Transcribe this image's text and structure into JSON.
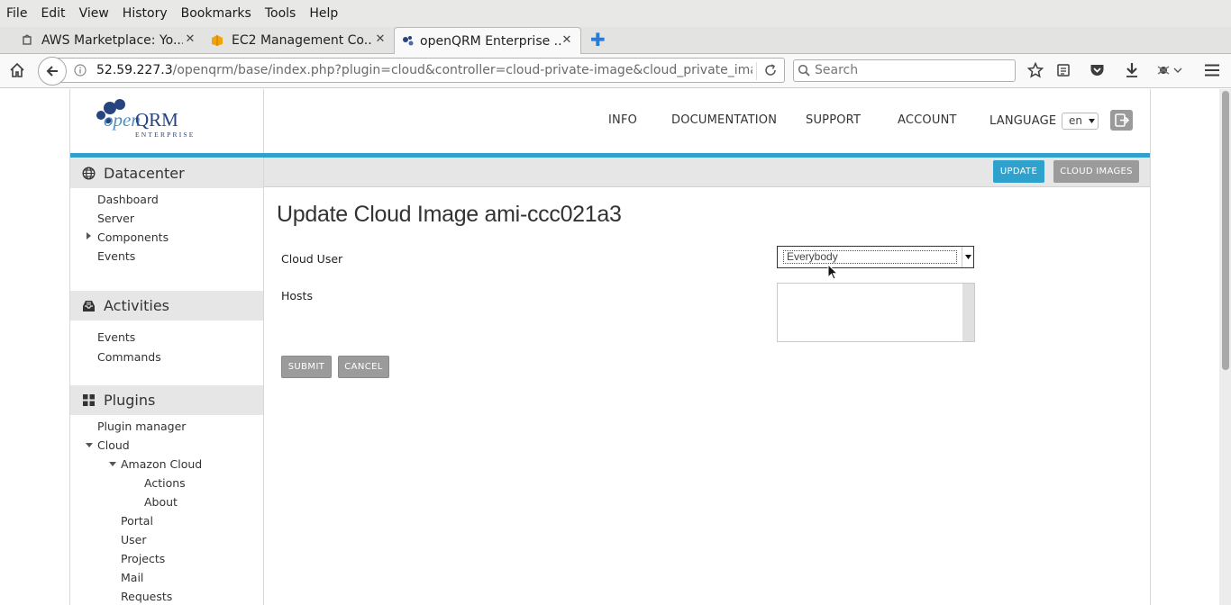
{
  "browser": {
    "menu": [
      "File",
      "Edit",
      "View",
      "History",
      "Bookmarks",
      "Tools",
      "Help"
    ],
    "menu_mnemonics": [
      "F",
      "E",
      "V",
      "s",
      "B",
      "T",
      "H"
    ],
    "tabs": [
      {
        "label": "AWS Marketplace: Yo...",
        "icon": "aws-icon"
      },
      {
        "label": "EC2 Management Co...",
        "icon": "cube-icon"
      },
      {
        "label": "openQRM Enterprise ...",
        "icon": "openqrm-icon",
        "active": true
      }
    ],
    "url_host": "52.59.227.3",
    "url_path": "/openqrm/base/index.php?plugin=cloud&controller=cloud-private-image&cloud_private_image=",
    "search_placeholder": "Search"
  },
  "header": {
    "logo_text_open": "open",
    "logo_text_qrm": "QRM",
    "logo_sub": "ENTERPRISE",
    "nav": [
      "INFO",
      "DOCUMENTATION",
      "SUPPORT",
      "ACCOUNT"
    ],
    "language_label": "LANGUAGE",
    "language_value": "en"
  },
  "toolbar": {
    "update_label": "UPDATE",
    "cloud_images_label": "CLOUD IMAGES"
  },
  "sidebar": {
    "datacenter": {
      "title": "Datacenter",
      "items": [
        "Dashboard",
        "Server",
        "Components",
        "Events"
      ]
    },
    "activities": {
      "title": "Activities",
      "items": [
        "Events",
        "Commands"
      ]
    },
    "plugins": {
      "title": "Plugins",
      "items": {
        "plugin_manager": "Plugin manager",
        "cloud": "Cloud",
        "amazon_cloud": "Amazon Cloud",
        "actions": "Actions",
        "about": "About",
        "portal": "Portal",
        "user": "User",
        "projects": "Projects",
        "mail": "Mail",
        "requests": "Requests"
      }
    }
  },
  "main": {
    "title": "Update Cloud Image ami-ccc021a3",
    "cloud_user_label": "Cloud User",
    "cloud_user_value": "Everybody",
    "hosts_label": "Hosts",
    "submit_label": "SUBMIT",
    "cancel_label": "CANCEL"
  },
  "colors": {
    "accent": "#2ea2cc",
    "gray_button": "#9b9b9b",
    "section_bg": "#e6e6e6"
  }
}
